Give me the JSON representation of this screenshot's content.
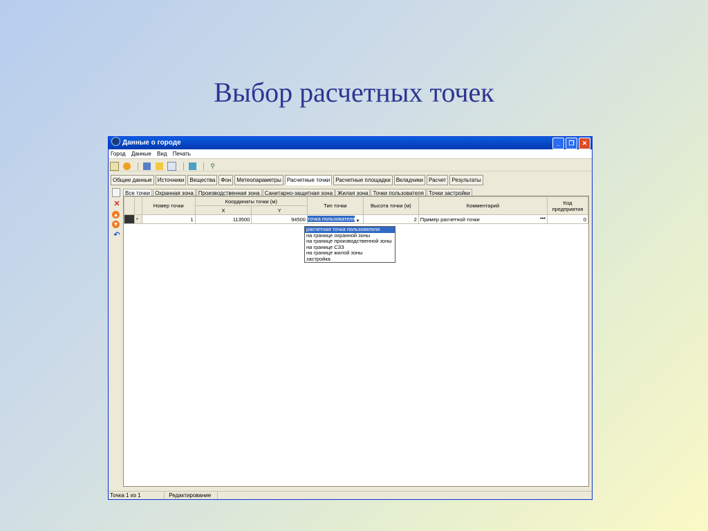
{
  "slide": {
    "title": "Выбор расчетных точек"
  },
  "window": {
    "title": "Данные о городе",
    "btn_min": "_",
    "btn_restore": "❐",
    "btn_close": "✕"
  },
  "menu": [
    "Город",
    "Данные",
    "Вид",
    "Печать"
  ],
  "main_tabs": [
    {
      "label": "Общие данные"
    },
    {
      "label": "Источники"
    },
    {
      "label": "Вещества"
    },
    {
      "label": "Фон"
    },
    {
      "label": "Метеопараметры"
    },
    {
      "label": "Расчетные точки",
      "active": true
    },
    {
      "label": "Расчетные площадки"
    },
    {
      "label": "Вкладчики"
    },
    {
      "label": "Расчет"
    },
    {
      "label": "Результаты"
    }
  ],
  "sub_tabs": [
    {
      "label": "Все точки",
      "active": true
    },
    {
      "label": "Охранная зона"
    },
    {
      "label": "Производственная зона"
    },
    {
      "label": "Санитарно-защитная зона"
    },
    {
      "label": "Жилая зона"
    },
    {
      "label": "Точки пользователя"
    },
    {
      "label": "Точки застройки"
    }
  ],
  "grid": {
    "headers": {
      "number": "Номер точки",
      "coords": "Координаты точки (м)",
      "x": "X",
      "y": "Y",
      "type": "Тип точки",
      "height": "Высота точки (м)",
      "comment": "Комментарий",
      "code": "Код предприятия"
    },
    "row": {
      "marker": "*",
      "number": "1",
      "x": "113500",
      "y": "94500",
      "type": "точка пользователя",
      "height": "2",
      "comment": "Пример расчетной точки",
      "comment_btn": "•••",
      "code": "0"
    }
  },
  "dropdown_options": [
    "расчетная точка пользователя",
    "на границе охранной зоны",
    "на границе производственной зоны",
    "на границе СЗЗ",
    "на границе жилой зоны",
    "застройка"
  ],
  "status": {
    "position": "Точка 1 из 1",
    "mode": "Редактирование"
  }
}
